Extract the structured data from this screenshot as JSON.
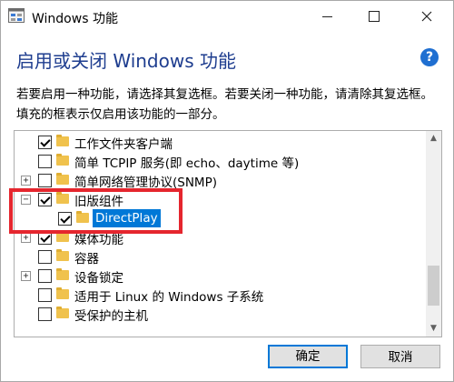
{
  "window": {
    "title": "Windows 功能",
    "controls": {
      "minimize": "minimize",
      "maximize": "maximize",
      "close": "close"
    }
  },
  "header": {
    "heading": "启用或关闭 Windows 功能",
    "help_symbol": "?"
  },
  "description": "若要启用一种功能，请选择其复选框。若要关闭一种功能，请清除其复选框。填充的框表示仅启用该功能的一部分。",
  "features": [
    {
      "label": "工作文件夹客户端",
      "checked": true,
      "expander": "",
      "selected": false
    },
    {
      "label": "简单 TCPIP 服务(即 echo、daytime 等)",
      "checked": false,
      "expander": "",
      "selected": false
    },
    {
      "label": "简单网络管理协议(SNMP)",
      "checked": false,
      "expander": "+",
      "selected": false
    },
    {
      "label": "旧版组件",
      "checked": true,
      "expander": "−",
      "selected": false
    },
    {
      "label": "DirectPlay",
      "checked": true,
      "expander": "",
      "selected": true,
      "child": true
    },
    {
      "label": "媒体功能",
      "checked": true,
      "expander": "+",
      "selected": false
    },
    {
      "label": "容器",
      "checked": false,
      "expander": "",
      "selected": false
    },
    {
      "label": "设备锁定",
      "checked": false,
      "expander": "+",
      "selected": false
    },
    {
      "label": "适用于 Linux 的 Windows 子系统",
      "checked": false,
      "expander": "",
      "selected": false
    },
    {
      "label": "受保护的主机",
      "checked": false,
      "expander": "",
      "selected": false
    }
  ],
  "buttons": {
    "ok": "确定",
    "cancel": "取消"
  },
  "colors": {
    "heading": "#1e3d8f",
    "selection": "#0078d7",
    "annotation": "#e5262e",
    "folder": "#f0c24d"
  }
}
